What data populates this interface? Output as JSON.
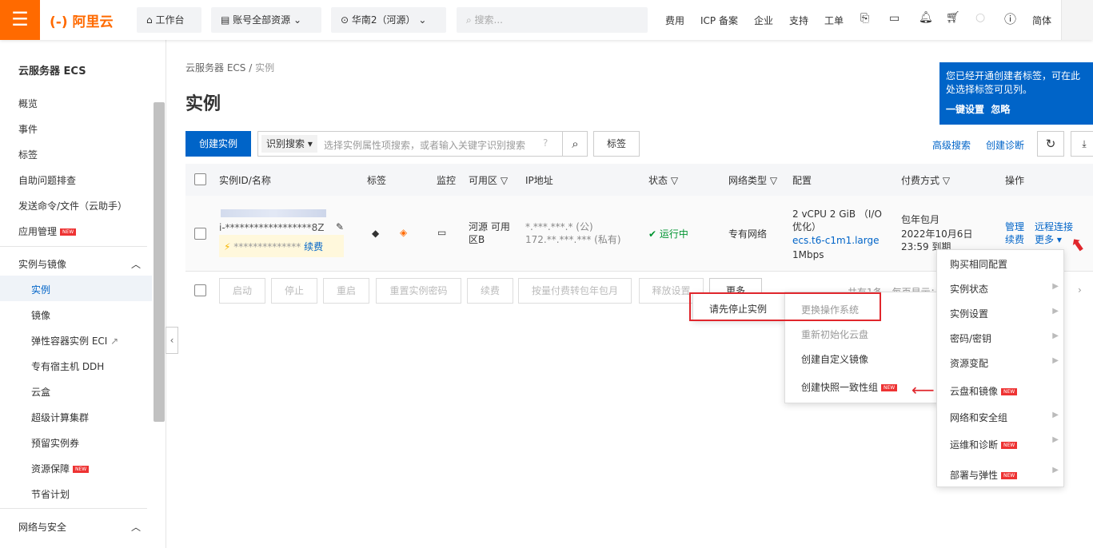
{
  "topbar": {
    "logo": "(-) 阿里云",
    "workbench": "工作台",
    "resources": "账号全部资源",
    "region": "华南2（河源）",
    "search_placeholder": "搜索...",
    "nav": [
      "费用",
      "ICP 备案",
      "企业",
      "支持",
      "工单"
    ],
    "lang": "简体"
  },
  "sidebar": {
    "title": "云服务器 ECS",
    "items": [
      "概览",
      "事件",
      "标签",
      "自助问题排查",
      "发送命令/文件（云助手）",
      "应用管理"
    ],
    "group1": "实例与镜像",
    "group1_items": [
      "实例",
      "镜像",
      "弹性容器实例 ECI",
      "专有宿主机 DDH",
      "云盒",
      "超级计算集群",
      "预留实例券",
      "资源保障",
      "节省计划"
    ],
    "group2": "网络与安全",
    "new_badge": "NEW"
  },
  "breadcrumb": [
    "云服务器 ECS",
    "实例"
  ],
  "page_title": "实例",
  "toolbar": {
    "create": "创建实例",
    "search_type": "识别搜索",
    "search_placeholder": "选择实例属性项搜索，或者输入关键字识别搜索",
    "tag": "标签",
    "advanced": "高级搜索",
    "diagnose": "创建诊断"
  },
  "notice": {
    "text": "您已经开通创建者标签，可在此处选择标签可见列。",
    "setup": "一键设置",
    "ignore": "忽略"
  },
  "table": {
    "headers": [
      "实例ID/名称",
      "标签",
      "监控",
      "可用区",
      "IP地址",
      "状态",
      "网络类型",
      "配置",
      "付费方式",
      "操作"
    ],
    "row": {
      "id": "i-******************8Z",
      "name": "**************",
      "renew": "续费",
      "zone": "河源 可用区B",
      "ip_public": "*.***.***.* (公)",
      "ip_private": "172.**.***.*** (私有)",
      "status": "运行中",
      "network": "专有网络",
      "config": "2 vCPU 2 GiB （I/O优化）",
      "type": "ecs.t6-c1m1.large",
      "bandwidth": "1Mbps",
      "billing": "包年包月",
      "expire": "2022年10月6日 23:59 到期",
      "ops": [
        "管理",
        "远程连接",
        "续费",
        "更多"
      ]
    }
  },
  "footer_buttons": [
    "启动",
    "停止",
    "重启",
    "重置实例密码",
    "续费",
    "按量付费转包年包月",
    "释放设置",
    "更多"
  ],
  "pagination": "共有1条，每页显示：",
  "menu_main": [
    "购买相同配置",
    "实例状态",
    "实例设置",
    "密码/密钥",
    "资源变配",
    "云盘和镜像",
    "网络和安全组",
    "运维和诊断",
    "部署与弹性"
  ],
  "menu_sub": [
    "更换操作系统",
    "重新初始化云盘",
    "创建自定义镜像",
    "创建快照一致性组"
  ],
  "tooltip": "请先停止实例",
  "colors": {
    "brand": "#ff6a00",
    "primary": "#0064c8",
    "success": "#009431",
    "annotation": "#e0262c"
  }
}
